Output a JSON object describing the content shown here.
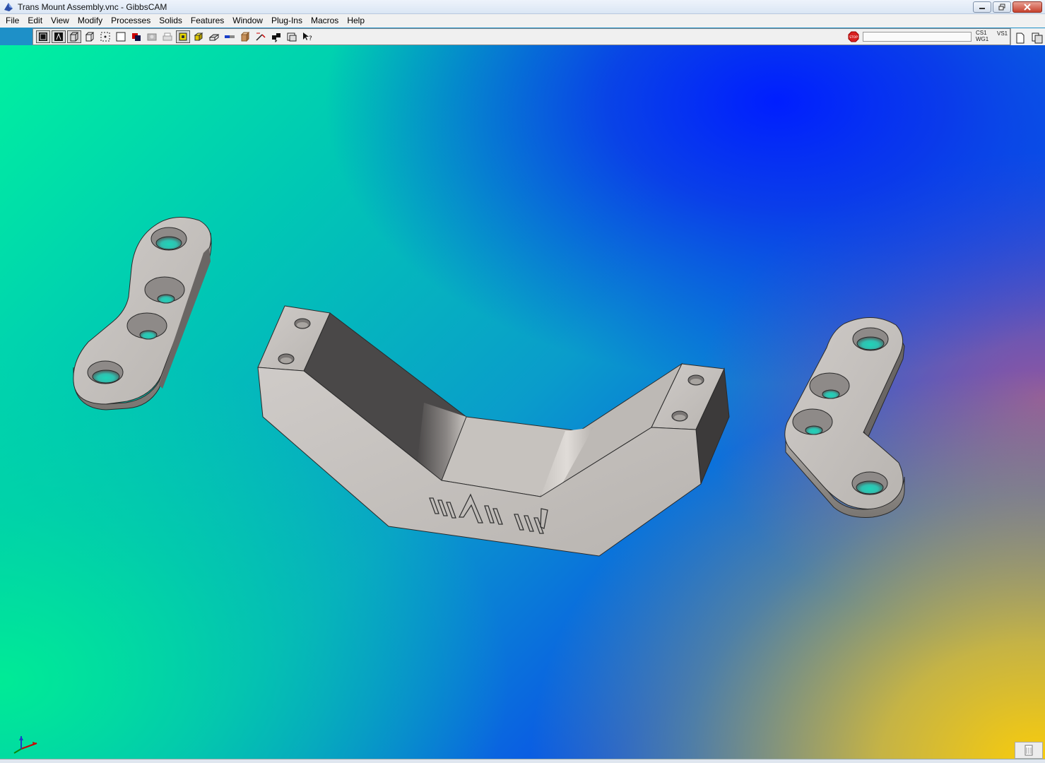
{
  "window": {
    "title": "Trans Mount Assembly.vnc - GibbsCAM"
  },
  "menu": [
    "File",
    "Edit",
    "View",
    "Modify",
    "Processes",
    "Solids",
    "Features",
    "Window",
    "Plug-Ins",
    "Macros",
    "Help"
  ],
  "status": {
    "cs_label": "CS1",
    "wg_label": "WG1",
    "vs_label": "VS1",
    "stop_label": "STOP"
  },
  "logo_text": "MA",
  "colors": {
    "part_face": "#c4c0bc",
    "part_shadow": "#4a4848",
    "part_edge": "#2a2a2a"
  }
}
